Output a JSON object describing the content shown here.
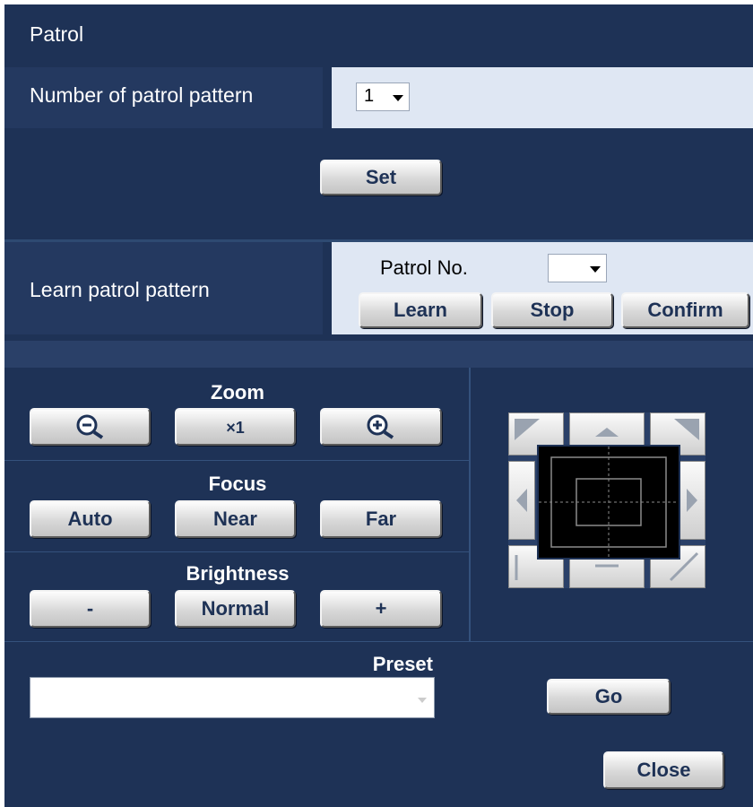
{
  "header": {
    "title": "Patrol"
  },
  "patrol_pattern": {
    "label": "Number of patrol pattern",
    "selected": "1"
  },
  "set_button": {
    "label": "Set"
  },
  "learn": {
    "label": "Learn patrol pattern",
    "patrol_no_label": "Patrol No.",
    "patrol_no_value": "",
    "buttons": {
      "learn": "Learn",
      "stop": "Stop",
      "confirm": "Confirm"
    }
  },
  "zoom": {
    "title": "Zoom",
    "x1_label": "×1",
    "out_icon": "zoom-out-icon",
    "in_icon": "zoom-in-icon"
  },
  "focus": {
    "title": "Focus",
    "auto": "Auto",
    "near": "Near",
    "far": "Far"
  },
  "brightness": {
    "title": "Brightness",
    "minus": "-",
    "normal": "Normal",
    "plus": "+"
  },
  "preset": {
    "title": "Preset",
    "value": "",
    "go": "Go"
  },
  "close": {
    "label": "Close"
  },
  "colors": {
    "panel_bg": "#1e3256",
    "label_bg": "#243960",
    "value_bg": "#dfe7f3",
    "button_text": "#1e3256"
  }
}
